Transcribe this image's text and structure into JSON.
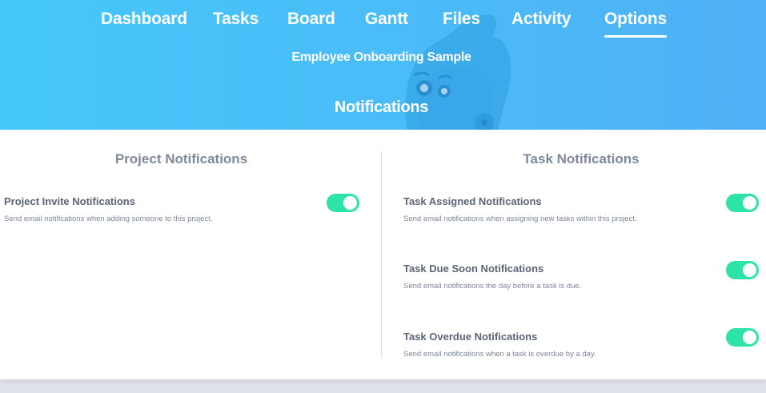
{
  "nav": {
    "items": [
      {
        "label": "Dashboard",
        "active": false
      },
      {
        "label": "Tasks",
        "active": false
      },
      {
        "label": "Board",
        "active": false
      },
      {
        "label": "Gantt",
        "active": false
      },
      {
        "label": "Files",
        "active": false
      },
      {
        "label": "Activity",
        "active": false
      },
      {
        "label": "Options",
        "active": true
      }
    ]
  },
  "header": {
    "project_name": "Employee Onboarding Sample",
    "page_title": "Notifications"
  },
  "project_notifications": {
    "title": "Project Notifications",
    "settings": [
      {
        "label": "Project Invite Notifications",
        "description": "Send email notifications when adding someone to this project.",
        "enabled": true
      }
    ]
  },
  "task_notifications": {
    "title": "Task Notifications",
    "settings": [
      {
        "label": "Task Assigned Notifications",
        "description": "Send email notifications when assigning new tasks within this project.",
        "enabled": true
      },
      {
        "label": "Task Due Soon Notifications",
        "description": "Send email notifications the day before a task is due.",
        "enabled": true
      },
      {
        "label": "Task Overdue Notifications",
        "description": "Send email notifications when a task is overdue by a day.",
        "enabled": true
      }
    ]
  },
  "colors": {
    "header_start": "#45c8fb",
    "header_end": "#4fb0f5",
    "toggle_on": "#2ee3a8",
    "heading_text": "#7e8a9c",
    "label_text": "#5b6576"
  }
}
